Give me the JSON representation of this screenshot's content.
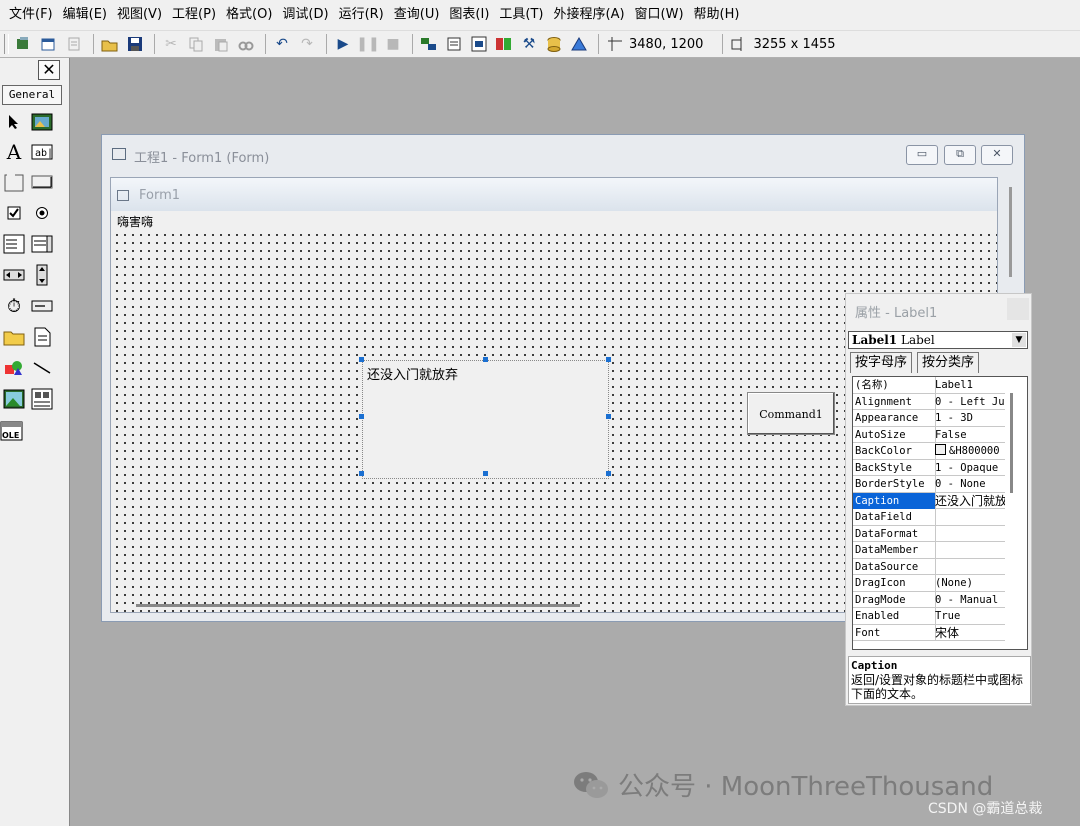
{
  "menubar": [
    "文件(F)",
    "编辑(E)",
    "视图(V)",
    "工程(P)",
    "格式(O)",
    "调试(D)",
    "运行(R)",
    "查询(U)",
    "图表(I)",
    "工具(T)",
    "外接程序(A)",
    "窗口(W)",
    "帮助(H)"
  ],
  "toolbar": {
    "position_readout": "3480, 1200",
    "size_readout": "3255 x 1455"
  },
  "toolbox": {
    "tab_label": "General",
    "close_glyph": "✕",
    "text_tool_glyph": "A",
    "textbox_tool_label": "ab|",
    "ole_label": "OLE"
  },
  "form_window": {
    "title": "工程1 - Form1 (Form)",
    "form_caption": "Form1",
    "menu_text": "嗨害嗨",
    "label_caption": "还没入门就放弃",
    "command_caption": "Command1"
  },
  "properties": {
    "title": "属性 - Label1",
    "object_name": "Label1",
    "object_type": "Label",
    "tabs": [
      "按字母序",
      "按分类序"
    ],
    "rows": [
      {
        "name": "(名称)",
        "value": "Label1"
      },
      {
        "name": "Alignment",
        "value": "0 - Left Ju"
      },
      {
        "name": "Appearance",
        "value": "1 - 3D"
      },
      {
        "name": "AutoSize",
        "value": "False"
      },
      {
        "name": "BackColor",
        "value": "&H800000"
      },
      {
        "name": "BackStyle",
        "value": "1 - Opaque"
      },
      {
        "name": "BorderStyle",
        "value": "0 - None"
      },
      {
        "name": "Caption",
        "value": "还没入门就放"
      },
      {
        "name": "DataField",
        "value": ""
      },
      {
        "name": "DataFormat",
        "value": ""
      },
      {
        "name": "DataMember",
        "value": ""
      },
      {
        "name": "DataSource",
        "value": ""
      },
      {
        "name": "DragIcon",
        "value": "(None)"
      },
      {
        "name": "DragMode",
        "value": "0 - Manual"
      },
      {
        "name": "Enabled",
        "value": "True"
      },
      {
        "name": "Font",
        "value": "宋体"
      }
    ],
    "description_title": "Caption",
    "description_text": "返回/设置对象的标题栏中或图标下面的文本。"
  },
  "watermark": {
    "text": "公众号 · MoonThreeThousand",
    "csdn": "CSDN @霸道总裁"
  }
}
